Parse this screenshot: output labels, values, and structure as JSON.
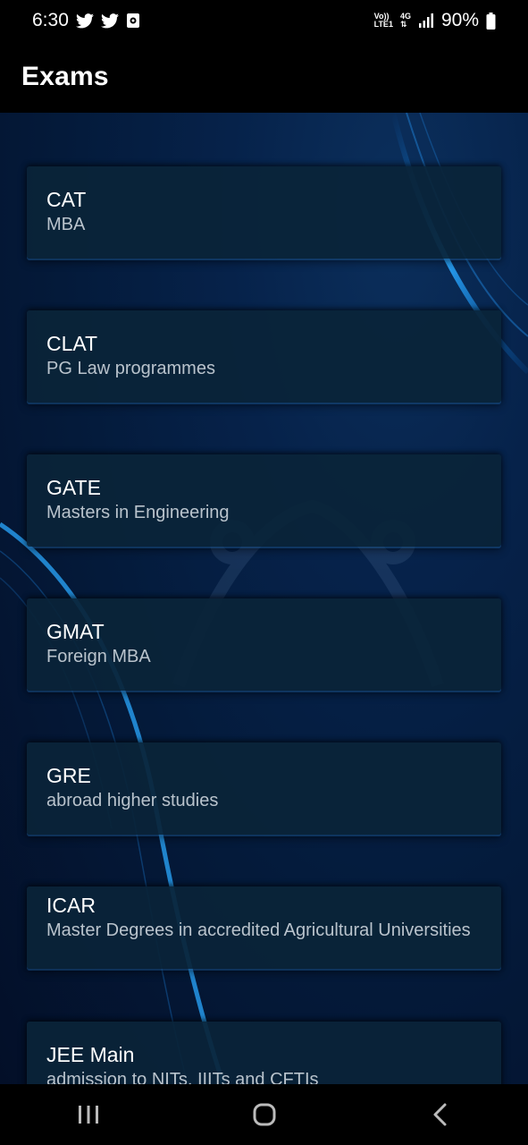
{
  "status_bar": {
    "time": "6:30",
    "battery": "90%",
    "network_top": "Vo))",
    "network_bottom": "LTE1",
    "net_type": "4G",
    "icons": [
      "twitter-icon",
      "twitter-icon",
      "notification-icon",
      "signal-icon",
      "battery-icon"
    ]
  },
  "app_bar": {
    "title": "Exams"
  },
  "exams": [
    {
      "title": "CAT",
      "subtitle": "MBA"
    },
    {
      "title": "CLAT",
      "subtitle": "PG Law programmes"
    },
    {
      "title": "GATE",
      "subtitle": "Masters in Engineering"
    },
    {
      "title": "GMAT",
      "subtitle": "Foreign MBA"
    },
    {
      "title": "GRE",
      "subtitle": "abroad higher studies"
    },
    {
      "title": "ICAR",
      "subtitle": "Master Degrees in accredited Agricultural Universities"
    },
    {
      "title": "JEE Main",
      "subtitle": "admission to NITs, IIITs and CFTIs"
    }
  ],
  "nav_bar": {
    "icons": [
      "recent-apps-icon",
      "home-icon",
      "back-icon"
    ]
  },
  "colors": {
    "background": "#041a3a",
    "card": "#0a2438",
    "subtitle": "#b9c3cc"
  }
}
